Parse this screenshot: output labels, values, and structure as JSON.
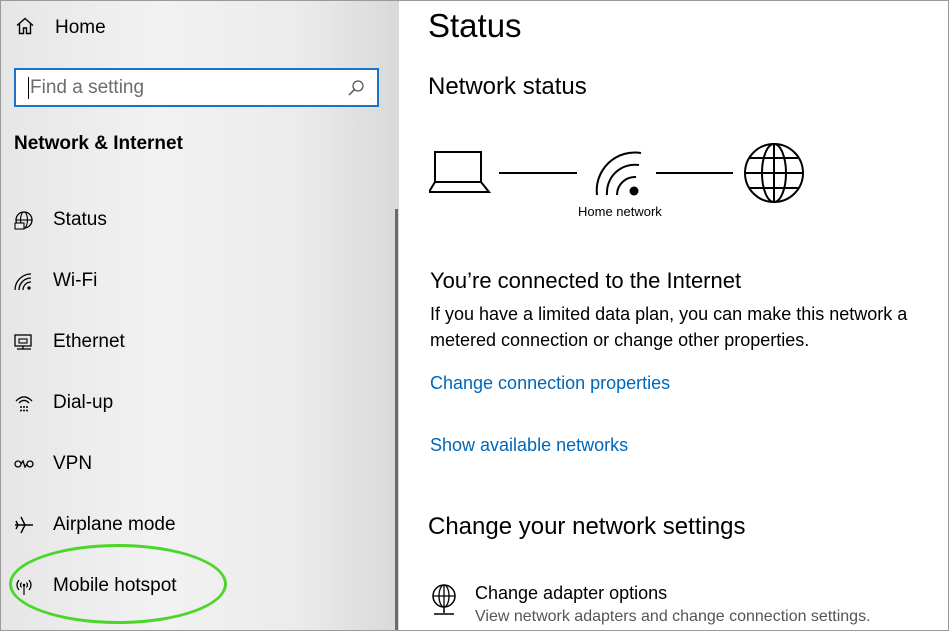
{
  "sidebar": {
    "home_label": "Home",
    "search_placeholder": "Find a setting",
    "section_title": "Network & Internet",
    "items": [
      {
        "label": "Status",
        "icon": "status-icon"
      },
      {
        "label": "Wi-Fi",
        "icon": "wifi-icon"
      },
      {
        "label": "Ethernet",
        "icon": "ethernet-icon"
      },
      {
        "label": "Dial-up",
        "icon": "dial-up-icon"
      },
      {
        "label": "VPN",
        "icon": "vpn-icon"
      },
      {
        "label": "Airplane mode",
        "icon": "airplane-icon"
      },
      {
        "label": "Mobile hotspot",
        "icon": "hotspot-icon"
      }
    ]
  },
  "main": {
    "title": "Status",
    "network_status_heading": "Network status",
    "network_label": "Home network",
    "connected_title": "You’re connected to the Internet",
    "connected_desc": "If you have a limited data plan, you can make this network a metered connection or change other properties.",
    "link_change_properties": "Change connection properties",
    "link_show_networks": "Show available networks",
    "change_settings_heading": "Change your network settings",
    "adapter_title": "Change adapter options",
    "adapter_desc": "View network adapters and change connection settings."
  },
  "colors": {
    "accent": "#0067b8",
    "search_border": "#1a73c8",
    "highlight": "#4cd629"
  }
}
